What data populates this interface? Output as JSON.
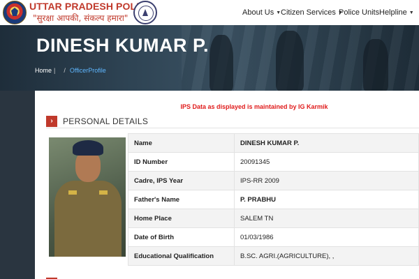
{
  "header": {
    "brand_title": "UTTAR PRADESH POLICE",
    "brand_tagline": "\"सुरक्षा आपकी, संकल्प हमारा\"",
    "nav": [
      {
        "label": "About Us",
        "has_dropdown": true
      },
      {
        "label": "Citizen Services",
        "has_dropdown": true
      },
      {
        "label": "Police Units",
        "has_dropdown": false
      },
      {
        "label": "Helpline",
        "has_dropdown": true
      }
    ]
  },
  "banner": {
    "officer_name": "DINESH KUMAR P.",
    "breadcrumb": {
      "home": "Home",
      "separator_1": "|",
      "separator_2": "/",
      "current": "OfficerProfile"
    }
  },
  "notice": "IPS Data as displayed is maintained by IG Karmik",
  "section": {
    "icon": "chevron-right-icon",
    "title": "PERSONAL DETAILS"
  },
  "details": [
    {
      "label": "Name",
      "value": "DINESH KUMAR P.",
      "bold": true
    },
    {
      "label": "ID Number",
      "value": "20091345",
      "bold": false
    },
    {
      "label": "Cadre, IPS Year",
      "value": "IPS-RR 2009",
      "bold": false
    },
    {
      "label": "Father's Name",
      "value": "P. PRABHU",
      "bold": true
    },
    {
      "label": "Home Place",
      "value": "SALEM TN",
      "bold": false
    },
    {
      "label": "Date of Birth",
      "value": "01/03/1986",
      "bold": false
    },
    {
      "label": "Educational Qualification",
      "value": "B.SC. AGRI.(AGRICULTURE), ,",
      "bold": false
    }
  ],
  "colors": {
    "accent_red": "#c0392b",
    "notice_red": "#e01b1b",
    "link_blue": "#5fb7ff"
  }
}
